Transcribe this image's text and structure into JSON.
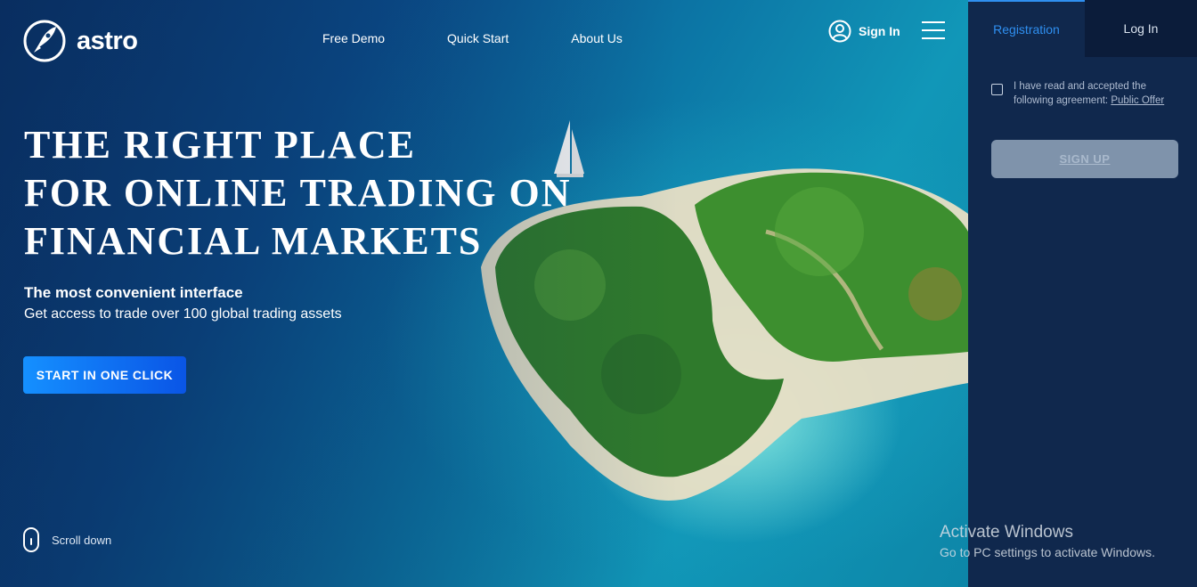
{
  "brand": {
    "name": "astro",
    "logo_icon": "rocket-icon"
  },
  "nav": {
    "items": [
      {
        "label": "Free Demo"
      },
      {
        "label": "Quick Start"
      },
      {
        "label": "About Us"
      }
    ]
  },
  "header": {
    "signin_label": "Sign In",
    "signin_icon": "user-icon",
    "menu_icon": "hamburger-icon"
  },
  "hero": {
    "headline_lines": [
      "THE RIGHT PLACE",
      "FOR ONLINE TRADING ON",
      "FINANCIAL MARKETS"
    ],
    "subtitle": "The most convenient interface",
    "subtext": "Get access to trade over 100 global trading assets",
    "cta_label": "START IN ONE CLICK",
    "scroll_label": "Scroll down"
  },
  "panel": {
    "tabs": [
      {
        "label": "Registration",
        "active": true
      },
      {
        "label": "Log In",
        "active": false
      }
    ],
    "agreement_text": "I have read and accepted the following agreement: ",
    "agreement_link": "Public Offer",
    "agreement_checked": false,
    "signup_label": "SIGN UP"
  },
  "watermark": {
    "title": "Activate Windows",
    "subtitle": "Go to PC settings to activate Windows."
  },
  "colors": {
    "accent": "#2f8ff0",
    "panel_bg": "#10284d",
    "cta_start": "#1590ff",
    "cta_end": "#0a55e6"
  }
}
